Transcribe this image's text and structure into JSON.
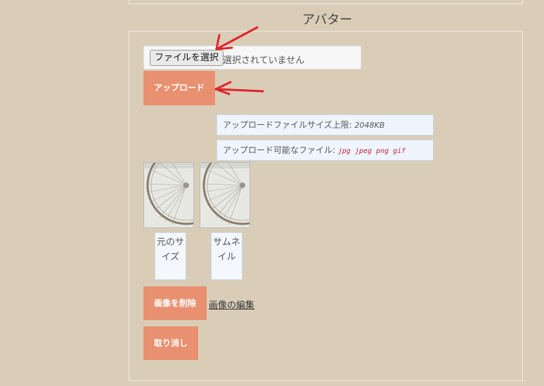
{
  "section_title": "アバター",
  "upload": {
    "choose_file_label": "ファイルを選択",
    "no_file_selected": "選択されていません",
    "upload_button": "アップロード"
  },
  "info": {
    "size_limit_label": "アップロードファイルサイズ上限: ",
    "size_limit_value": "2048KB",
    "allowed_label": "アップロード可能なファイル: ",
    "allowed_types": "jpg jpeg png gif"
  },
  "images": {
    "original_caption": "元のサイズ",
    "thumbnail_caption": "サムネイル"
  },
  "actions": {
    "delete_image": "画像を削除",
    "edit_image": "画像の編集",
    "cancel": "取り消し"
  },
  "colors": {
    "background": "#d9cdb8",
    "button": "#e8906f",
    "info_box": "#eef5ff",
    "annotation_arrow": "#e0242a",
    "file_ext": "#c0243a"
  }
}
